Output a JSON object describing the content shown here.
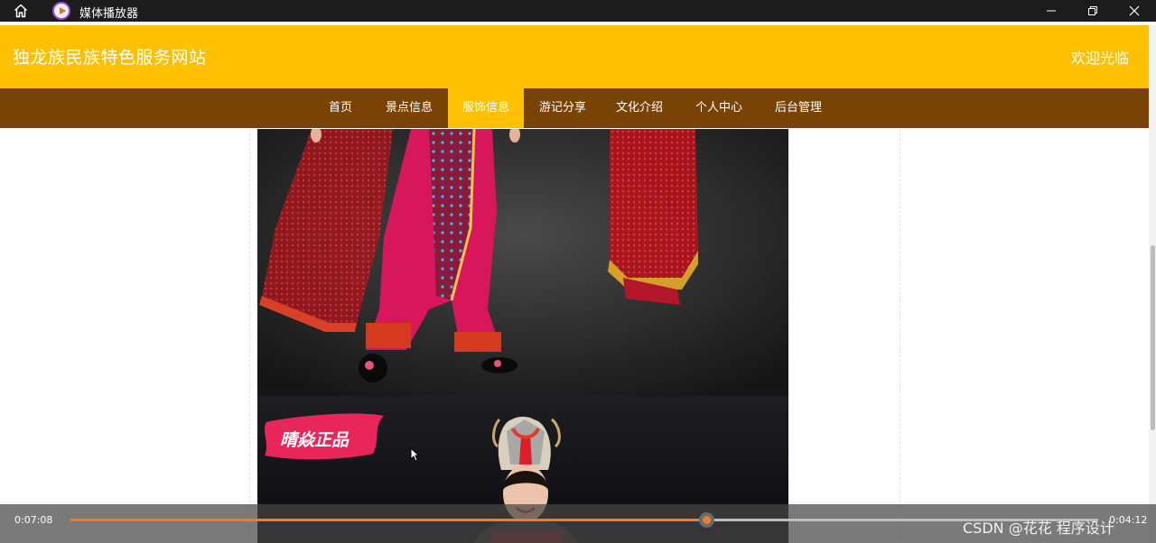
{
  "window": {
    "app_title": "媒体播放器",
    "icons": [
      "home-icon",
      "media-player-app-icon",
      "minimize-icon",
      "restore-icon",
      "close-icon"
    ]
  },
  "site": {
    "title": "独龙族民族特色服务网站",
    "welcome": "欢迎光临",
    "colors": {
      "header": "#fec000",
      "nav": "#7a4306",
      "nav_active": "#fec000"
    }
  },
  "nav": {
    "items": [
      {
        "label": "首页",
        "active": false
      },
      {
        "label": "景点信息",
        "active": false
      },
      {
        "label": "服饰信息",
        "active": true
      },
      {
        "label": "游记分享",
        "active": false
      },
      {
        "label": "文化介绍",
        "active": false
      },
      {
        "label": "个人中心",
        "active": false
      },
      {
        "label": "后台管理",
        "active": false
      }
    ]
  },
  "content": {
    "banner_text": "晴焱正品"
  },
  "player": {
    "current_time": "0:07:08",
    "total_time": "0:04:12",
    "progress": 0.619,
    "accent": "#f07c2a"
  },
  "watermark": "CSDN @花花 程序设计"
}
